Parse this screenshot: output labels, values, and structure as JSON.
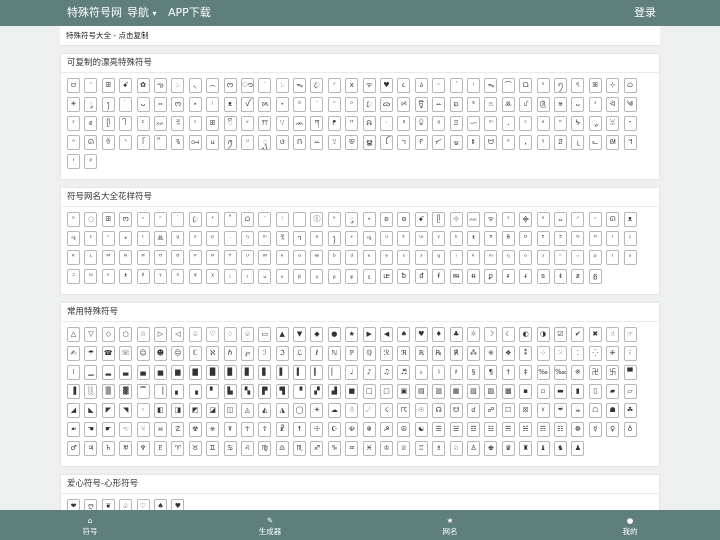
{
  "nav": {
    "brand": "特殊符号网",
    "menu": "导航",
    "caret": "▾",
    "app": "APP下载",
    "login": "登录"
  },
  "breadcrumb": "特殊符号大全 - 点击复制",
  "sections": [
    {
      "title": "可复制的漂亮特殊符号",
      "symbols": [
        "ㅁ",
        "ᵔ",
        "ꕥ",
        "ꗃ",
        "✿",
        "ఌ",
        "჻",
        "৲",
        "෴",
        "ᰔ",
        "ൗ",
        "ᐝ",
        "჻",
        "ᯓ",
        "ꦿ",
        "ᐟ",
        "ⅹ",
        "ᯤ",
        "♥",
        "૮",
        "ა",
        "ᵕ",
        "ˊ",
        "ᵎ",
        "ᯓ",
        "⌒",
        "ᗝ",
        "ᵒ",
        "ꪆ",
        "ৎ",
        "ꕤ",
        "⊹",
        "ᜊ",
        "☀",
        "༘",
        "ꫂ",
        "ᜒ",
        "ᴗ",
        "⑅",
        "ᰔ",
        "⋆",
        "ᵎ",
        "ᴥ",
        "ꪜ",
        "ᝰ",
        "˖",
        "꙳",
        "ᐝ",
        "ᵔ",
        "ᵒ",
        "ꦿ",
        "ᯅ",
        "ꗯ",
        "ਊ",
        "ꕀ",
        "ᨳ",
        "ᔆ",
        "ෆ",
        "ꔛ",
        "ᦔ",
        "༊",
        "ෂ",
        "ᴗ",
        "ᵌ",
        "ᐛ",
        "༄",
        "ᶻ",
        "ꫀ",
        "ᥫ",
        "ᩤ",
        "ᑦ",
        "ᨐ",
        "ꉂ",
        "ᵋ",
        "ꕥ",
        "ꦼ",
        "ᵛ",
        "ꔫ",
        "ꗷ",
        "ᨏ",
        "ཀ",
        "ᖰ",
        "ᴴ",
        "ᕱ",
        "ᐧ",
        "ᕁ",
        "ꐑ",
        "ᵍ",
        "ꕶ",
        "ᜑ",
        "ᵐ",
        "ꓸ",
        "ᶜ",
        "ᵃ",
        "ᑋ",
        "ᖭ",
        "ೄ",
        "ꈍ",
        "ᕀ",
        "ᐢ",
        "ᘏ",
        "ꈊ",
        "ᐠ",
        "ᥬ",
        "ᩚ",
        "ꕦ",
        "ꗢ",
        "ᥙ",
        "ꪑ",
        "ᵘ",
        "ꦽ",
        "ଓ",
        "ᑎ",
        "ꕁ",
        "ꗹ",
        "ꕣ",
        "ൠ",
        "ꪶ",
        "ᥐ",
        "ᠻ",
        "ᜆ",
        "ᚗ",
        "ꔪ",
        "ᗢ",
        "ᐤ",
        "ꓹ",
        "ᵑ",
        "ꗟ",
        "ᥨ",
        "ᓚ",
        "ᘛ",
        "ᖿ",
        "ᑊ",
        "ᵖ"
      ]
    },
    {
      "title": "符号网名大全花样符号",
      "symbols": [
        "ᵒ",
        "◌",
        "ꕥ",
        "ᰔ",
        "ᵕ",
        "ᵔ",
        "˙",
        "ꦿ",
        "⁺",
        "˚",
        "ᜊ",
        "ᐝ",
        "ᵎ",
        "ㅤ",
        "ⓛ",
        "ᵛ",
        "༘",
        "˖",
        "ʚ",
        "ɞ",
        "ꗃ",
        "ᥫ",
        "⊹",
        "ᨐ",
        "ᯤ",
        "ᵌ",
        "᯽",
        "ᵒ",
        "ᴗ",
        "ᐟ",
        "ᵕ",
        "ᘏ",
        "ᴥ",
        "ಇ",
        "ᵋ",
        "ᵔ",
        "⋆",
        "ᵗ",
        "ꔛ",
        "ᵍ",
        "ᶻ",
        "ᵖ",
        "ᐧ",
        "ᵑ",
        "ᵐ",
        "ꉂ",
        "ᥐ",
        "ᵃ",
        "ꫂ",
        "ᕀ",
        "ಇ",
        "ᵘ",
        "ᵏ",
        "ᵚ",
        "ᵞ",
        "ᵟ",
        "ᵜ",
        "ᴮ",
        "ᴯ",
        "ᴰ",
        "ᴱ",
        "ᴲ",
        "ᴳ",
        "ᴴ",
        "ᴵ",
        "ᴶ",
        "ᴷ",
        "ᴸ",
        "ᴹ",
        "ᴺ",
        "ᴻ",
        "ᴼ",
        "ᴽ",
        "ᴾ",
        "ᴿ",
        "ᵀ",
        "ᵁ",
        "ᵂ",
        "ᵄ",
        "ᵅ",
        "ᵆ",
        "ᵇ",
        "ᵈ",
        "ᵉ",
        "ᵊ",
        "ᵋ",
        "ᵌ",
        "ᵍ",
        "ᵎ",
        "ᵏ",
        "ᵐ",
        "ᵑ",
        "ᵒ",
        "ᵓ",
        "ᵔ",
        "ᵕ",
        "ᵖ",
        "ᵗ",
        "ᵘ",
        "ᵙ",
        "ᵚ",
        "ᵛ",
        "ᵜ",
        "ᵝ",
        "ᵞ",
        "ᵟ",
        "ᵠ",
        "ᵡ",
        "ᵢ",
        "ᵣ",
        "ᵤ",
        "ᵥ",
        "ᵦ",
        "ᵧ",
        "ᵨ",
        "ᵩ",
        "ᵪ",
        "ᵫ",
        "ᵬ",
        "ᵭ",
        "ᵮ",
        "ᵯ",
        "ᵰ",
        "ᵱ",
        "ᵲ",
        "ᵳ",
        "ᵴ",
        "ᵵ",
        "ᵶ",
        "ᵷ"
      ]
    },
    {
      "title": "常用特殊符号",
      "symbols": [
        "△",
        "▽",
        "◇",
        "○",
        "☆",
        "▷",
        "◁",
        "♤",
        "♡",
        "♢",
        "♧",
        "▭",
        "▲",
        "▼",
        "◆",
        "●",
        "★",
        "▶",
        "◀",
        "♠",
        "♥",
        "♦",
        "♣",
        "☼",
        "☽",
        "☾",
        "◐",
        "◑",
        "☑",
        "✔",
        "✖",
        "☝",
        "☞",
        "✍",
        "☂",
        "☎",
        "☏",
        "☺",
        "☻",
        "☹",
        "ℂ",
        "ℵ",
        "ℏ",
        "℘",
        "ℐ",
        "ℑ",
        "ℒ",
        "ℓ",
        "ℕ",
        "ℙ",
        "ℚ",
        "ℛ",
        "ℜ",
        "ℝ",
        "℞",
        "℟",
        "⁂",
        "※",
        "❖",
        "⁑",
        "⁘",
        "⁙",
        "⁚",
        "⁛",
        "⁜",
        "⁝",
        "⁞",
        "▁",
        "▂",
        "▃",
        "▄",
        "▅",
        "▆",
        "▇",
        "█",
        "▉",
        "▊",
        "▋",
        "▌",
        "▍",
        "▎",
        "▏",
        "♩",
        "♪",
        "♫",
        "♬",
        "♭",
        "♮",
        "♯",
        "§",
        "¶",
        "†",
        "‡",
        "‰",
        "‱",
        "※",
        "卍",
        "卐",
        "▀",
        "▐",
        "░",
        "▒",
        "▓",
        "▔",
        "▕",
        "▖",
        "▗",
        "▘",
        "▙",
        "▚",
        "▛",
        "▜",
        "▝",
        "▞",
        "▟",
        "■",
        "□",
        "▢",
        "▣",
        "▤",
        "▥",
        "▦",
        "▧",
        "▨",
        "▩",
        "▪",
        "▫",
        "▬",
        "▮",
        "▯",
        "▰",
        "▱",
        "◢",
        "◣",
        "◤",
        "◥",
        "◦",
        "◧",
        "◨",
        "◩",
        "◪",
        "◫",
        "◬",
        "◭",
        "◮",
        "◯",
        "☀",
        "☁",
        "☃",
        "☄",
        "☇",
        "☈",
        "☉",
        "☊",
        "☋",
        "☌",
        "☍",
        "☐",
        "☒",
        "☓",
        "☔",
        "☕",
        "☖",
        "☗",
        "☘",
        "☙",
        "☚",
        "☛",
        "☜",
        "☟",
        "☠",
        "☡",
        "☢",
        "☣",
        "☤",
        "☥",
        "☦",
        "☧",
        "☨",
        "☩",
        "☪",
        "☫",
        "☬",
        "☭",
        "☮",
        "☯",
        "☰",
        "☱",
        "☲",
        "☳",
        "☴",
        "☵",
        "☶",
        "☷",
        "☸",
        "☿",
        "♀",
        "♁",
        "♂",
        "♃",
        "♄",
        "♅",
        "♆",
        "♇",
        "♈",
        "♉",
        "♊",
        "♋",
        "♌",
        "♍",
        "♎",
        "♏",
        "♐",
        "♑",
        "♒",
        "♓",
        "♔",
        "♕",
        "♖",
        "♗",
        "♘",
        "♙",
        "♚",
        "♛",
        "♜",
        "♝",
        "♞",
        "♟"
      ]
    },
    {
      "title": "爱心符号-心形符号",
      "symbols": [
        "❤",
        "ღ",
        "❦",
        "♤",
        "♡",
        "♠",
        "♥"
      ]
    }
  ],
  "bottom_nav": [
    {
      "label": "符号",
      "icon": "home-icon",
      "glyph": "⌂"
    },
    {
      "label": "生成器",
      "icon": "wrench-icon",
      "glyph": "✎"
    },
    {
      "label": "网名",
      "icon": "star-icon",
      "glyph": "★"
    },
    {
      "label": "我的",
      "icon": "user-icon",
      "glyph": "●"
    }
  ]
}
